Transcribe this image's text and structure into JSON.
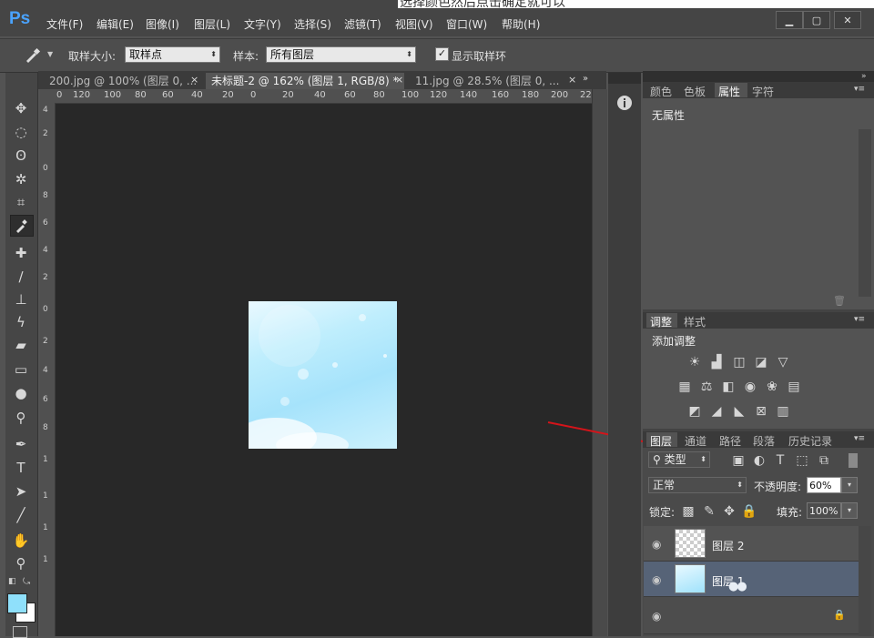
{
  "caption": "选择颜色然后点击确定就可以",
  "app": {
    "logo": "Ps"
  },
  "menu": [
    "文件(F)",
    "编辑(E)",
    "图像(I)",
    "图层(L)",
    "文字(Y)",
    "选择(S)",
    "滤镜(T)",
    "视图(V)",
    "窗口(W)",
    "帮助(H)"
  ],
  "window_controls": [
    "▁",
    "▢",
    "✕"
  ],
  "options": {
    "sample_size_label": "取样大小:",
    "sample_size_value": "取样点",
    "sample_label": "样本:",
    "sample_value": "所有图层",
    "show_ring_label": "显示取样环",
    "show_ring_checked": true
  },
  "tabs": [
    {
      "label": "200.jpg @ 100% (图层 0, ...",
      "active": false
    },
    {
      "label": "未标题-2 @ 162% (图层 1, RGB/8) *",
      "active": true
    },
    {
      "label": "11.jpg @ 28.5% (图层 0, ...",
      "active": false
    }
  ],
  "ruler_h": [
    "0",
    "120",
    "100",
    "80",
    "60",
    "40",
    "20",
    "0",
    "20",
    "40",
    "60",
    "80",
    "100",
    "120",
    "140",
    "160",
    "180",
    "200",
    "220"
  ],
  "ruler_v": [
    "4",
    "2",
    "0",
    "8",
    "6",
    "4",
    "2",
    "0",
    "2",
    "4",
    "6",
    "8",
    "1",
    "1",
    "1",
    "1"
  ],
  "properties": {
    "tabs": [
      "颜色",
      "色板",
      "属性",
      "字符"
    ],
    "active_tab": "属性",
    "content": "无属性"
  },
  "adjustments": {
    "tabs": [
      "调整",
      "样式"
    ],
    "title": "添加调整",
    "icons_row1": [
      "brightness-icon",
      "levels-icon",
      "curves-icon",
      "exposure-icon",
      "vibrance-icon"
    ],
    "icons_row2": [
      "hue-saturation-icon",
      "color-balance-icon",
      "black-white-icon",
      "photo-filter-icon",
      "channel-mixer-icon",
      "color-lookup-icon"
    ],
    "icons_row3": [
      "invert-icon",
      "posterize-icon",
      "threshold-icon",
      "selective-color-icon",
      "gradient-map-icon"
    ]
  },
  "layers": {
    "tabs": [
      "图层",
      "通道",
      "路径",
      "段落",
      "历史记录"
    ],
    "filter_label": "类型",
    "blend_mode": "正常",
    "opacity_label": "不透明度:",
    "opacity_value": "60%",
    "lock_label": "锁定:",
    "fill_label": "填充:",
    "fill_value": "100%",
    "items": [
      {
        "name": "图层 2",
        "selected": false
      },
      {
        "name": "图层 1",
        "selected": true
      },
      {
        "name": "",
        "selected": false,
        "locked": true
      }
    ]
  },
  "colors": {
    "foreground": "#8fe0fb",
    "background": "#ffffff",
    "annotation_arrow": "#d4141a"
  }
}
